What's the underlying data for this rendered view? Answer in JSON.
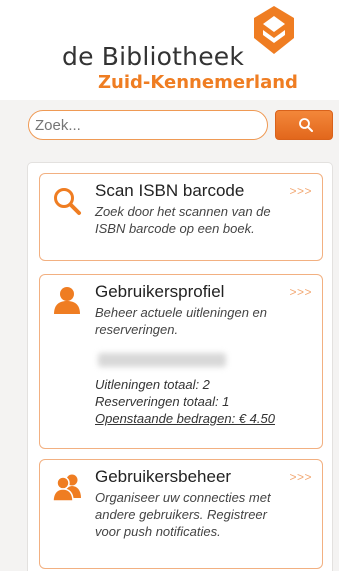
{
  "header": {
    "logo_line1": "de Bibliotheek",
    "logo_line2": "Zuid-Kennemerland",
    "brand_color": "#ef7d22"
  },
  "search": {
    "placeholder": "Zoek...",
    "button_icon": "search-icon"
  },
  "cards": [
    {
      "title": "Scan ISBN barcode",
      "chevron": ">>>",
      "icon": "magnifier-icon",
      "description": "Zoek door het scannen van de ISBN barcode op een boek."
    },
    {
      "title": "Gebruikersprofiel",
      "chevron": ">>>",
      "icon": "user-icon",
      "description": "Beheer actuele uitleningen en reserveringen.",
      "loans_total": "Uitleningen totaal: 2",
      "reservations_total": "Reserveringen totaal: 1",
      "outstanding": "Openstaande bedragen: € 4.50"
    },
    {
      "title": "Gebruikersbeheer",
      "chevron": ">>>",
      "icon": "users-icon",
      "description": "Organiseer uw connecties met andere gebruikers. Registreer voor push notificaties."
    }
  ]
}
